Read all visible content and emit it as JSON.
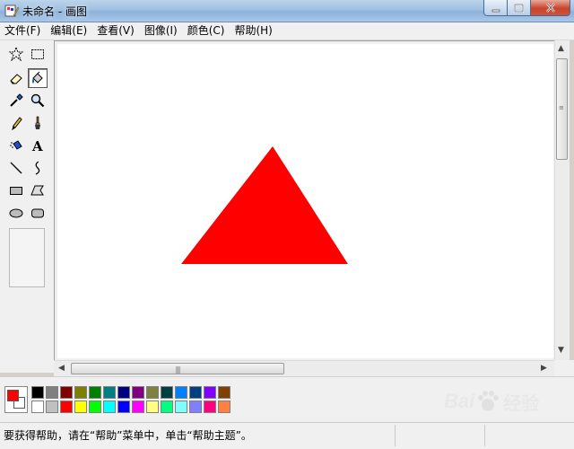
{
  "window": {
    "title": "未命名 - 画图",
    "controls": {
      "minimize": "minimize",
      "maximize": "maximize",
      "close": "close"
    }
  },
  "menu": [
    {
      "label": "文件(F)"
    },
    {
      "label": "编辑(E)"
    },
    {
      "label": "查看(V)"
    },
    {
      "label": "图像(I)"
    },
    {
      "label": "颜色(C)"
    },
    {
      "label": "帮助(H)"
    }
  ],
  "tools": [
    {
      "name": "free-select-icon",
      "icon": "star-select"
    },
    {
      "name": "rect-select-icon",
      "icon": "rect-select"
    },
    {
      "name": "eraser-icon",
      "icon": "eraser"
    },
    {
      "name": "fill-bucket-icon",
      "icon": "bucket",
      "active": true
    },
    {
      "name": "color-picker-icon",
      "icon": "dropper"
    },
    {
      "name": "magnifier-icon",
      "icon": "magnifier"
    },
    {
      "name": "pencil-icon",
      "icon": "pencil"
    },
    {
      "name": "brush-icon",
      "icon": "brush"
    },
    {
      "name": "airbrush-icon",
      "icon": "airbrush"
    },
    {
      "name": "text-icon",
      "icon": "A"
    },
    {
      "name": "line-icon",
      "icon": "line"
    },
    {
      "name": "curve-icon",
      "icon": "curve"
    },
    {
      "name": "rectangle-icon",
      "icon": "rect"
    },
    {
      "name": "polygon-icon",
      "icon": "polygon"
    },
    {
      "name": "ellipse-icon",
      "icon": "ellipse"
    },
    {
      "name": "rounded-rect-icon",
      "icon": "rounded-rect"
    }
  ],
  "canvas": {
    "shape": "triangle",
    "fill_color": "#ff0000"
  },
  "palette": {
    "foreground": "#ff0000",
    "background": "#ffffff",
    "row1": [
      "#000000",
      "#808080",
      "#800000",
      "#808000",
      "#008000",
      "#008080",
      "#000080",
      "#800080",
      "#808040",
      "#004040",
      "#0080ff",
      "#004080",
      "#8000ff",
      "#804000"
    ],
    "row2": [
      "#ffffff",
      "#c0c0c0",
      "#ff0000",
      "#ffff00",
      "#00ff00",
      "#00ffff",
      "#0000ff",
      "#ff00ff",
      "#ffff80",
      "#00ff80",
      "#80ffff",
      "#8080ff",
      "#ff0080",
      "#ff8040"
    ]
  },
  "status": {
    "text": "要获得帮助，请在“帮助”菜单中，单击“帮助主题”。"
  },
  "watermark": {
    "text": "Bai",
    "text2": "经验"
  }
}
